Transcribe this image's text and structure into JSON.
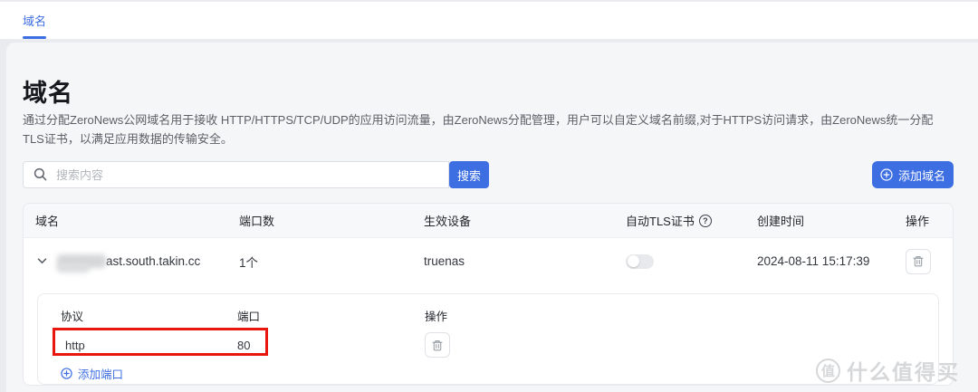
{
  "tabbar": {
    "items": [
      {
        "label": "域名",
        "active": true
      }
    ]
  },
  "page": {
    "title": "域名",
    "description": "通过分配ZeroNews公网域名用于接收 HTTP/HTTPS/TCP/UDP的应用访问流量，由ZeroNews分配管理，用户可以自定义域名前缀,对于HTTPS访问请求，由ZeroNews统一分配TLS证书，以满足应用数据的传输安全。"
  },
  "toolbar": {
    "search_placeholder": "搜索内容",
    "search_button": "搜索",
    "add_domain_button": "添加域名"
  },
  "table": {
    "headers": [
      "域名",
      "端口数",
      "生效设备",
      "自动TLS证书",
      "创建时间",
      "操作"
    ],
    "help_icon": "?",
    "row": {
      "domain_visible_suffix": "ast.south.takin.cc",
      "domain_prefix_redacted": true,
      "port_count": "1个",
      "device": "truenas",
      "auto_tls_enabled": false,
      "created_at": "2024-08-11 15:17:39"
    }
  },
  "sub_table": {
    "headers": [
      "协议",
      "端口",
      "操作"
    ],
    "rows": [
      {
        "protocol": "http",
        "port": "80"
      }
    ],
    "add_port_link": "添加端口"
  },
  "annotation": {
    "type": "highlight-box",
    "color": "#e8160c"
  },
  "watermark": {
    "badge": "值",
    "text": "什么值得买"
  },
  "colors": {
    "accent_blue": "#3d6ee2",
    "panel_bg": "#f5f6f8",
    "table_header_bg": "#f7f8fa"
  }
}
